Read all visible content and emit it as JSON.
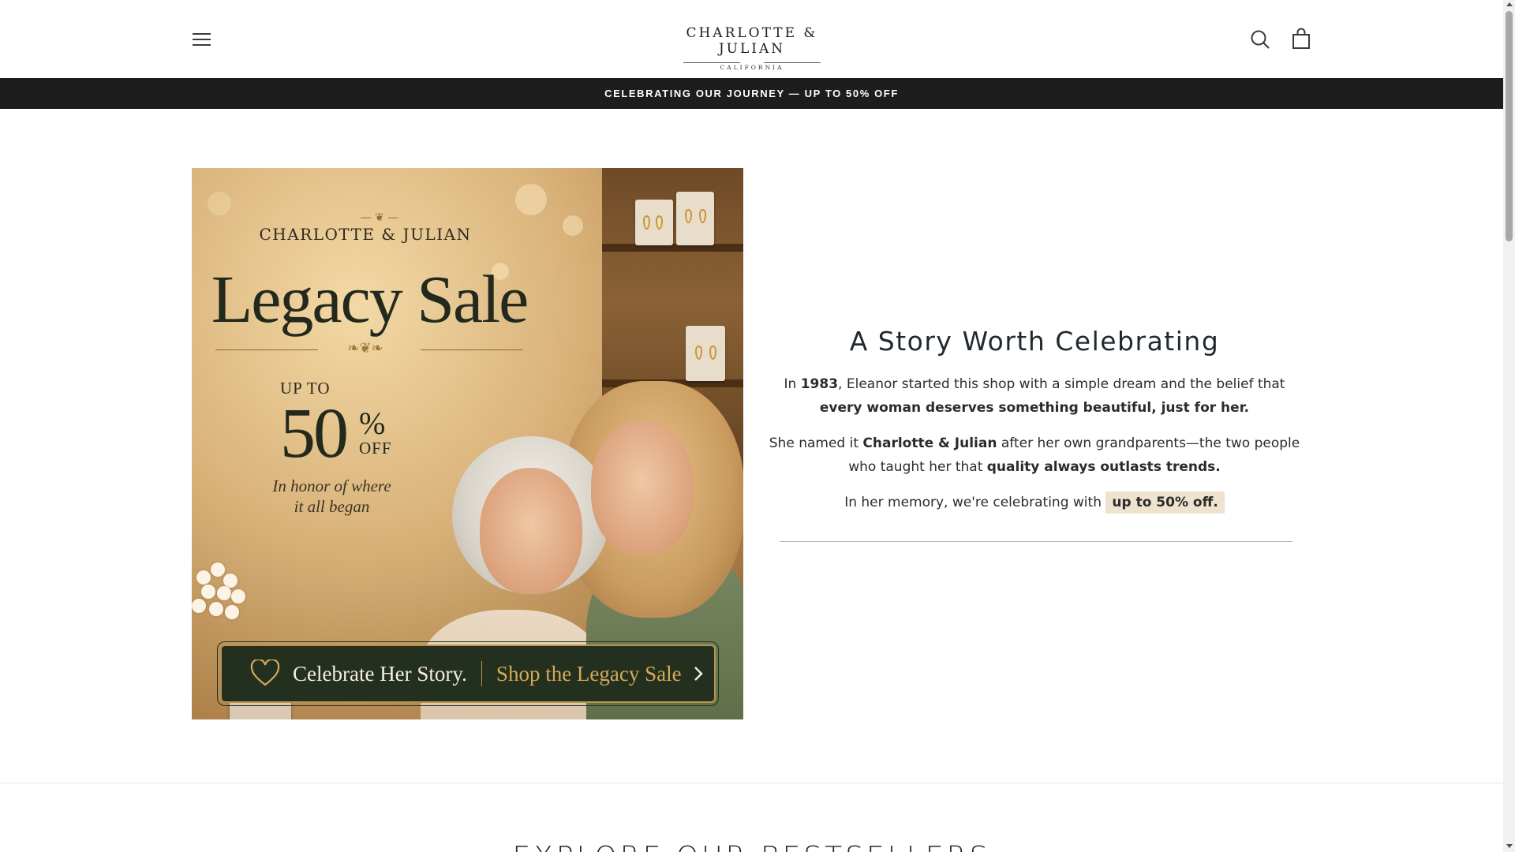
{
  "header": {
    "menu_icon": "hamburger-menu-icon",
    "logo": {
      "name": "CHARLOTTE & JULIAN",
      "tagline": "CALIFORNIA"
    },
    "search_icon": "search-icon",
    "cart_icon": "shopping-bag-icon"
  },
  "announcement": {
    "text": "CELEBRATING OUR JOURNEY — UP TO 50% OFF"
  },
  "hero_banner": {
    "brand": "CHARLOTTE & JULIAN",
    "title": "Legacy Sale",
    "up_to": "UP TO",
    "percent": "50",
    "percent_sign": "%",
    "off": "OFF",
    "honor_line1": "In honor of where",
    "honor_line2": "it all began",
    "cta_celebrate": "Celebrate Her Story.",
    "cta_shop": "Shop the Legacy Sale",
    "cta_icon": "heart-icon",
    "cta_arrow_icon": "chevron-right-icon",
    "accent_color": "#b6954f",
    "cta_bg_color": "#24301f"
  },
  "story": {
    "title": "A Story Worth Celebrating",
    "p1": {
      "t1": "In ",
      "year": "1983",
      "t2": ", Eleanor started this shop with a simple dream and the belief that ",
      "bold": "every woman deserves something beautiful, just for her."
    },
    "p2": {
      "t1": "She named it ",
      "brand": "Charlotte & Julian",
      "t2": " after her own grandparents—the two people who taught her that ",
      "bold": "quality always outlasts trends."
    },
    "p3": {
      "t1": "In her memory, we're celebrating with ",
      "highlight": "up to 50% off."
    },
    "highlight_color": "#efe3cf"
  },
  "bestsellers": {
    "heading": "EXPLORE OUR BESTSELLERS"
  },
  "theme": {
    "announcement_bg": "#1d1d1d",
    "text_color": "#1f2a2e"
  }
}
